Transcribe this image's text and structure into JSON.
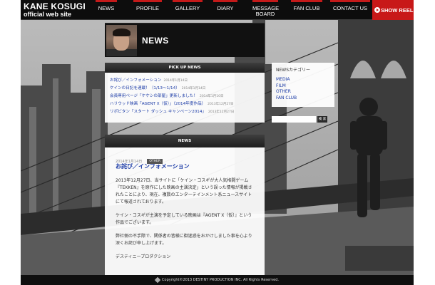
{
  "brand": {
    "name": "KANE KOSUGI",
    "subtitle": "official web site"
  },
  "nav": {
    "items": [
      {
        "label": "NEWS"
      },
      {
        "label": "PROFILE"
      },
      {
        "label": "GALLERY"
      },
      {
        "label": "DIARY"
      },
      {
        "label": "MESSAGE BOARD"
      },
      {
        "label": "FAN CLUB"
      },
      {
        "label": "CONTACT US"
      }
    ],
    "show_reel": "SHOW REEL",
    "accent_color": "#c41a1a"
  },
  "title_bar": {
    "title": "NEWS"
  },
  "pickup": {
    "heading": "PICK UP NEWS",
    "items": [
      {
        "title": "お詫び／インフォメーション",
        "date": "2014年1月14日"
      },
      {
        "title": "ケインの日記を連載！（1/13〜1/14）",
        "date": "2014年1月14日"
      },
      {
        "title": "会員専用ページ「ケケシの部屋」更新しました！",
        "date": "2014年1月10日"
      },
      {
        "title": "ハリウッド映画「AGENT X（仮）」（2014年度作品）",
        "date": "2013年12月27日"
      },
      {
        "title": "リポビタン「スタート ダッシュ キャンペーン2014」",
        "date": "2013年12月27日"
      }
    ]
  },
  "categories": {
    "heading": "NEWSカテゴリー",
    "items": [
      "MEDIA",
      "FILM",
      "OTHER",
      "FAN CLUB"
    ]
  },
  "search": {
    "placeholder": "",
    "button": "検 索"
  },
  "news": {
    "heading": "NEWS",
    "date": "2014年1月14日",
    "tag": "OTHER",
    "title": "お詫び／インフォメーション",
    "paragraphs": [
      "2013年12月27日、当サイトに「ケイン・コスギが大人気格闘ゲーム『TEKKEN』を原作にした映画の主演決定」という誤った情報が掲載されたことにより、現在、複数のエンターテインメント系ニュースサイトにて報道されております。",
      "ケイン・コスギが主演を予定している映画は『AGENT X（仮）』という作品でございます。",
      "弊社側の不手際で、関係者の皆様に御迷惑をおかけしました事を心より深くお詫び申し上げます。",
      "デスティニープロダクション"
    ]
  },
  "footer": {
    "copyright": "Copyright©2013 DESTINY PRODUCTION INC. All Rights Reserved."
  }
}
